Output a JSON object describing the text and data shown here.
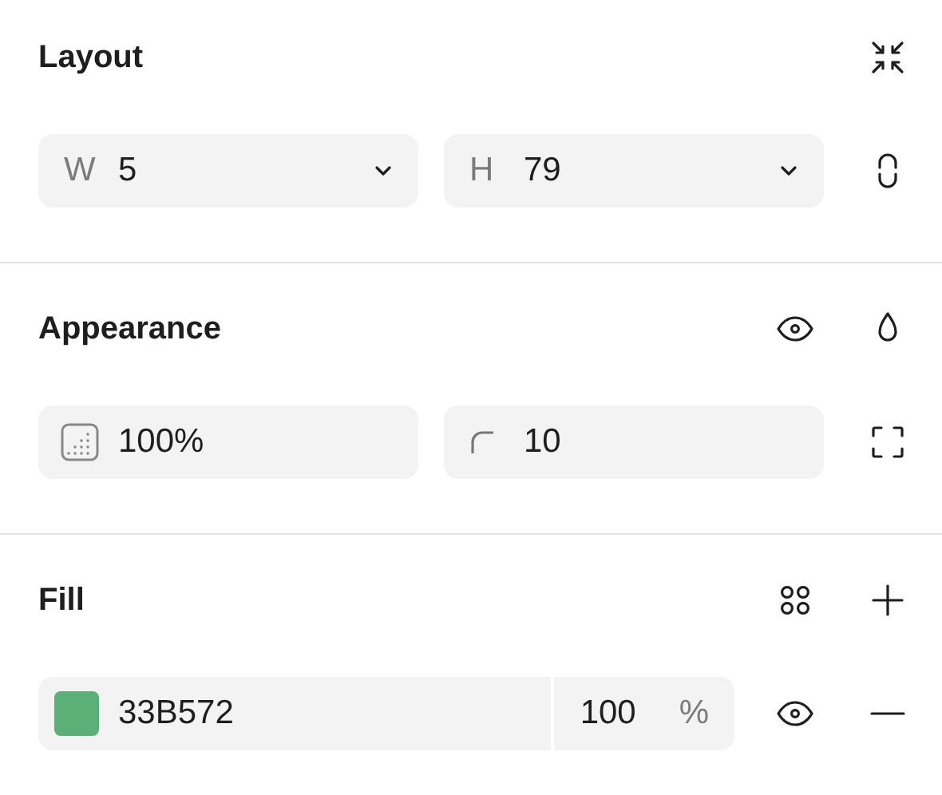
{
  "layout": {
    "title": "Layout",
    "width": {
      "label": "W",
      "value": "5"
    },
    "height": {
      "label": "H",
      "value": "79"
    }
  },
  "appearance": {
    "title": "Appearance",
    "opacity": "100%",
    "corner_radius": "10"
  },
  "fill": {
    "title": "Fill",
    "paints": [
      {
        "color": "#5bb077",
        "hex": "33B572",
        "opacity": "100",
        "unit": "%"
      }
    ]
  }
}
